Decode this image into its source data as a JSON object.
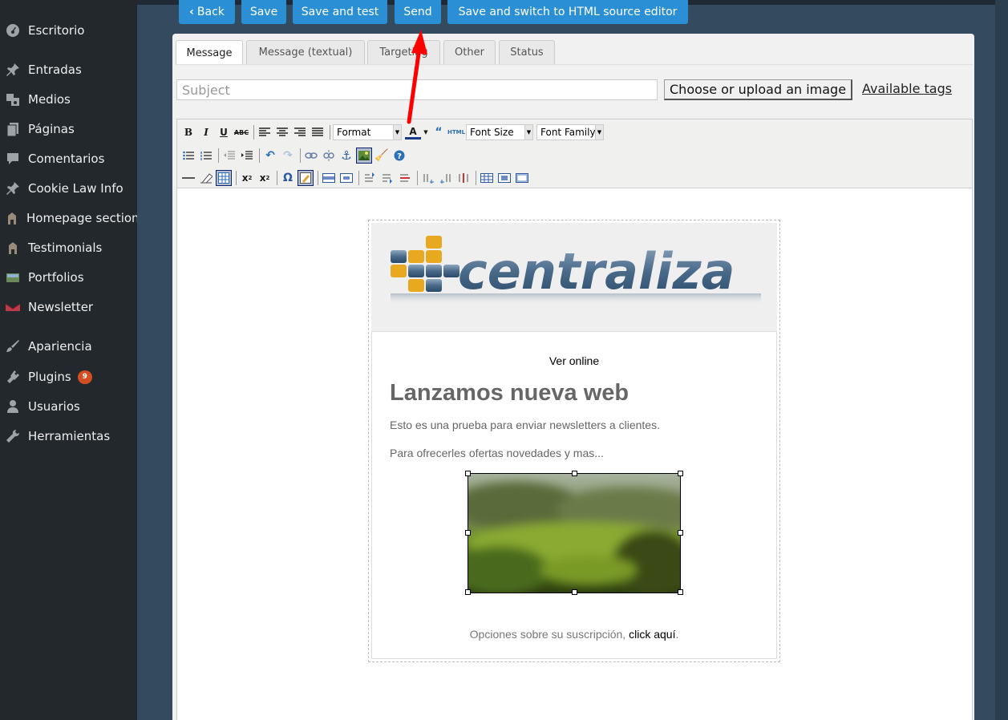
{
  "sidebar": {
    "items": [
      {
        "label": "Escritorio",
        "icon": "dashboard-icon"
      },
      {
        "label": "Entradas",
        "icon": "pin-icon"
      },
      {
        "label": "Medios",
        "icon": "media-icon"
      },
      {
        "label": "Páginas",
        "icon": "pages-icon"
      },
      {
        "label": "Comentarios",
        "icon": "comments-icon"
      },
      {
        "label": "Cookie Law Info",
        "icon": "pin-icon"
      },
      {
        "label": "Homepage sections",
        "icon": "building-icon"
      },
      {
        "label": "Testimonials",
        "icon": "building-icon"
      },
      {
        "label": "Portfolios",
        "icon": "portfolio-icon"
      },
      {
        "label": "Newsletter",
        "icon": "newsletter-icon"
      },
      {
        "label": "Apariencia",
        "icon": "brush-icon"
      },
      {
        "label": "Plugins",
        "icon": "plugin-icon",
        "badge": "9"
      },
      {
        "label": "Usuarios",
        "icon": "users-icon"
      },
      {
        "label": "Herramientas",
        "icon": "wrench-icon"
      }
    ]
  },
  "toolbar_buttons": {
    "back": "Back",
    "save": "Save",
    "save_and_test": "Save and test",
    "send": "Send",
    "save_switch": "Save and switch to HTML source editor"
  },
  "tabs": [
    "Message",
    "Message (textual)",
    "Targeting",
    "Other",
    "Status"
  ],
  "subject": {
    "placeholder": "Subject",
    "value": ""
  },
  "choose_image": "Choose or upload an image",
  "available_tags": "Available tags",
  "editor_toolbar": {
    "format": "Format",
    "font_size": "Font Size",
    "font_family": "Font Family"
  },
  "newsletter": {
    "logo_text": "centraliza",
    "ver_online": "Ver online",
    "heading": "Lanzamos nueva web",
    "p1": "Esto es una prueba para enviar newsletters a clientes.",
    "p2": "Para ofrecerles ofertas novedades y mas...",
    "footer_text": "Opciones sobre su suscripción, ",
    "footer_link": "click aquí",
    "footer_end": "."
  },
  "colors": {
    "sidebar_bg": "#23282d",
    "frame_bg": "#334a5f",
    "button_blue": "#2b8fd6",
    "badge": "#d54e21",
    "arrow": "#ff0000"
  }
}
